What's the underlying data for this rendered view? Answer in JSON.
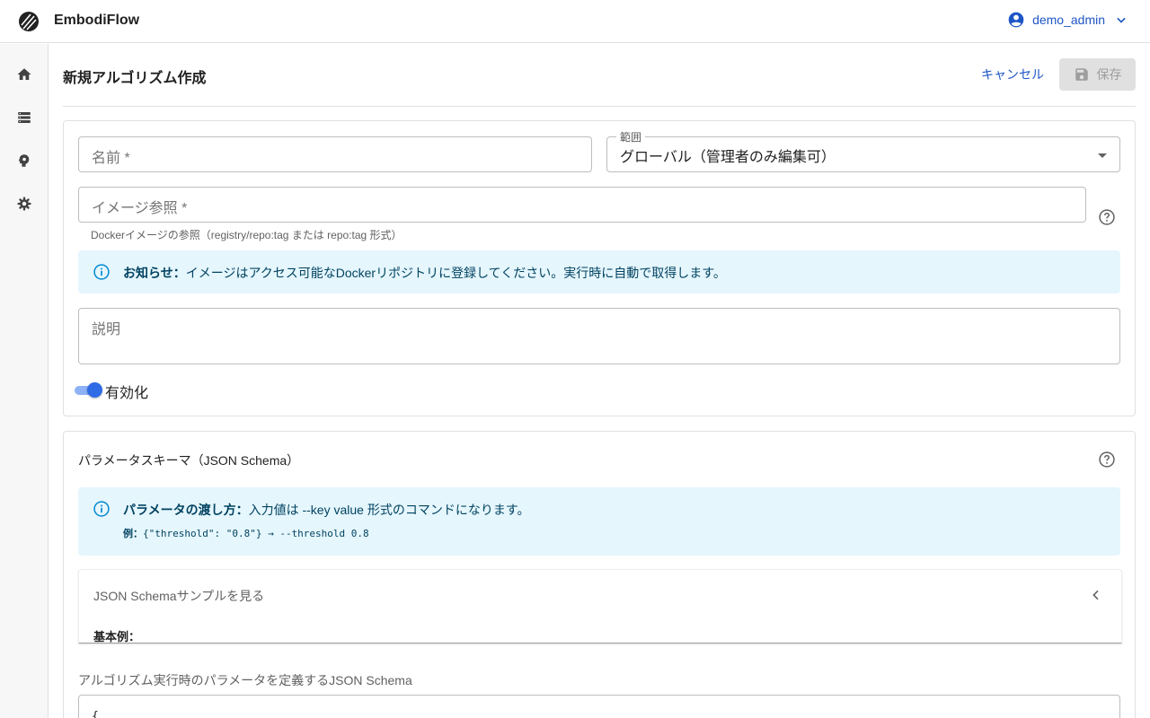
{
  "app": {
    "brand": "EmbodiFlow",
    "user": "demo_admin"
  },
  "sidebar": {
    "items": [
      {
        "name": "home",
        "icon": "home-icon"
      },
      {
        "name": "list",
        "icon": "list-icon"
      },
      {
        "name": "algorithm",
        "icon": "brain-icon"
      },
      {
        "name": "settings",
        "icon": "gear-icon"
      }
    ]
  },
  "header": {
    "title": "新規アルゴリズム作成",
    "cancel_label": "キャンセル",
    "save_label": "保存"
  },
  "form": {
    "name_placeholder": "名前 *",
    "scope_label": "範囲",
    "scope_value": "グローバル（管理者のみ編集可）",
    "image_placeholder": "イメージ参照 *",
    "image_helper": "Dockerイメージの参照（registry/repo:tag または repo:tag 形式）",
    "notice_title": "お知らせ：",
    "notice_text": "イメージはアクセス可能なDockerリポジトリに登録してください。実行時に自動で取得します。",
    "description_placeholder": "説明",
    "enabled_label": "有効化",
    "enabled": true
  },
  "schema_section": {
    "title": "パラメータスキーマ（JSON Schema）",
    "info_title": "パラメータの渡し方：",
    "info_text": "入力値は --key value 形式のコマンドになります。",
    "example_label": "例：",
    "example_code": "{\"threshold\": \"0.8\"} → --threshold 0.8",
    "accordion_title": "JSON Schemaサンプルを見る",
    "accordion_body": "基本例：",
    "schema_label": "アルゴリズム実行時のパラメータを定義するJSON Schema",
    "schema_value": "{"
  },
  "colors": {
    "primary": "#1e56c6",
    "info_bg": "#e5f6fd",
    "info_text": "#014361",
    "switch": "#2f6be5"
  }
}
